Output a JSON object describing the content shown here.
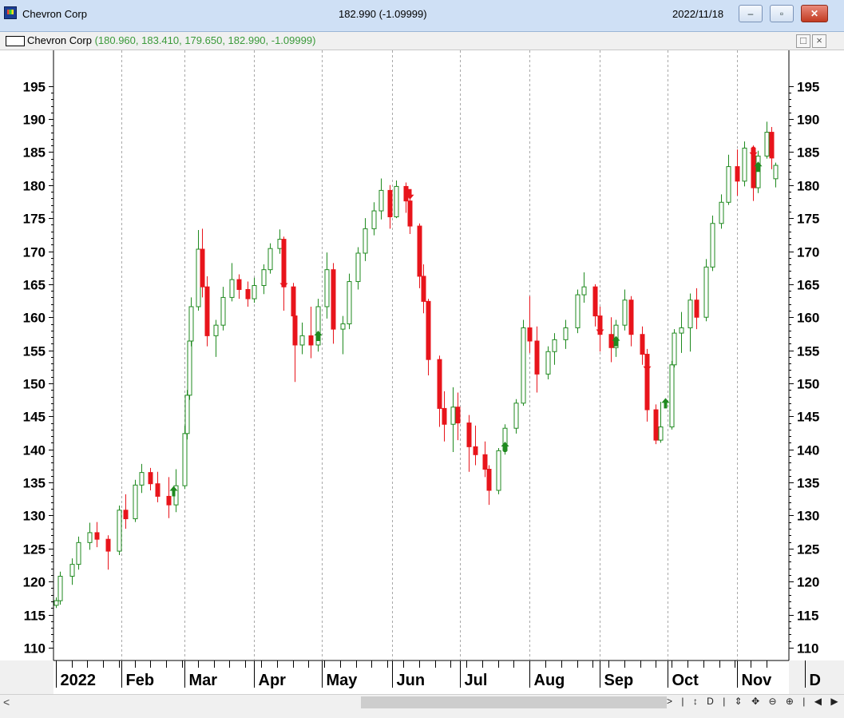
{
  "window": {
    "title": "Chevron Corp",
    "price_change": "182.990 (-1.09999)",
    "date": "2022/11/18",
    "minimize_label": "–",
    "maximize_label": "▫",
    "close_label": "✕"
  },
  "subwindow": {
    "title": "Chevron Corp",
    "ohlc": "(180.960, 183.410, 179.650, 182.990, -1.09999)",
    "restore_label": "□",
    "close_label": "×"
  },
  "scrollbar": {
    "left_arrow": "<",
    "tools": [
      ">",
      "|",
      "↕",
      "D",
      "|",
      "⇕",
      "✥",
      "⊖",
      "⊕",
      "|",
      "◀",
      "▶",
      "⊟"
    ]
  },
  "colors": {
    "up": "#1f8a1f",
    "down": "#e8141b",
    "grid": "#a8a8a8"
  },
  "chart_data": {
    "type": "candlestick",
    "title": "Chevron Corp",
    "y_ticks": [
      195,
      190,
      185,
      180,
      175,
      170,
      165,
      160,
      155,
      150,
      145,
      140,
      135,
      130,
      125,
      120,
      115,
      110
    ],
    "ylim": [
      109.5,
      197.5
    ],
    "x_labels": [
      "2022",
      "Feb",
      "Mar",
      "Apr",
      "May",
      "Jun",
      "Jul",
      "Aug",
      "Sep",
      "Oct",
      "Nov",
      "D"
    ],
    "grid": "vertical dashed at month boundaries",
    "series": [
      {
        "date": "2022-01-03",
        "o": 116.4,
        "h": 117.6,
        "l": 116.0,
        "c": 117.1
      },
      {
        "date": "2022-01-05",
        "o": 117.1,
        "h": 121.5,
        "l": 116.5,
        "c": 120.8
      },
      {
        "date": "2022-01-10",
        "o": 120.8,
        "h": 123.5,
        "l": 119.5,
        "c": 122.6
      },
      {
        "date": "2022-01-13",
        "o": 122.6,
        "h": 126.8,
        "l": 121.8,
        "c": 125.9
      },
      {
        "date": "2022-01-18",
        "o": 125.9,
        "h": 128.9,
        "l": 124.8,
        "c": 127.4
      },
      {
        "date": "2022-01-21",
        "o": 127.4,
        "h": 129.0,
        "l": 125.2,
        "c": 126.4
      },
      {
        "date": "2022-01-26",
        "o": 126.4,
        "h": 127.0,
        "l": 121.8,
        "c": 124.6
      },
      {
        "date": "2022-01-31",
        "o": 124.6,
        "h": 131.5,
        "l": 124.0,
        "c": 130.8
      },
      {
        "date": "2022-02-03",
        "o": 130.8,
        "h": 133.2,
        "l": 128.0,
        "c": 129.5
      },
      {
        "date": "2022-02-07",
        "o": 129.5,
        "h": 135.4,
        "l": 129.0,
        "c": 134.6
      },
      {
        "date": "2022-02-10",
        "o": 134.6,
        "h": 137.8,
        "l": 133.4,
        "c": 136.5
      },
      {
        "date": "2022-02-14",
        "o": 136.5,
        "h": 137.2,
        "l": 133.8,
        "c": 134.8
      },
      {
        "date": "2022-02-17",
        "o": 134.8,
        "h": 136.6,
        "l": 132.0,
        "c": 132.9
      },
      {
        "date": "2022-02-22",
        "o": 132.9,
        "h": 135.8,
        "l": 129.6,
        "c": 131.6
      },
      {
        "date": "2022-02-25",
        "o": 131.6,
        "h": 137.0,
        "l": 130.5,
        "c": 134.5
      },
      {
        "date": "2022-03-01",
        "o": 134.5,
        "h": 143.6,
        "l": 134.0,
        "c": 142.4
      },
      {
        "date": "2022-03-02",
        "o": 142.4,
        "h": 149.0,
        "l": 141.5,
        "c": 148.2
      },
      {
        "date": "2022-03-03",
        "o": 148.2,
        "h": 157.6,
        "l": 147.5,
        "c": 156.4
      },
      {
        "date": "2022-03-04",
        "o": 156.4,
        "h": 163.0,
        "l": 155.6,
        "c": 161.6
      },
      {
        "date": "2022-03-07",
        "o": 161.6,
        "h": 173.2,
        "l": 161.0,
        "c": 170.3
      },
      {
        "date": "2022-03-09",
        "o": 170.3,
        "h": 173.4,
        "l": 163.0,
        "c": 164.6
      },
      {
        "date": "2022-03-11",
        "o": 164.6,
        "h": 166.2,
        "l": 155.6,
        "c": 157.2
      },
      {
        "date": "2022-03-15",
        "o": 157.2,
        "h": 159.6,
        "l": 154.0,
        "c": 158.8
      },
      {
        "date": "2022-03-18",
        "o": 158.8,
        "h": 164.6,
        "l": 158.0,
        "c": 163.0
      },
      {
        "date": "2022-03-22",
        "o": 163.0,
        "h": 168.2,
        "l": 162.4,
        "c": 165.7
      },
      {
        "date": "2022-03-25",
        "o": 165.7,
        "h": 166.5,
        "l": 162.8,
        "c": 164.2
      },
      {
        "date": "2022-03-29",
        "o": 164.2,
        "h": 165.4,
        "l": 161.6,
        "c": 162.8
      },
      {
        "date": "2022-04-01",
        "o": 162.8,
        "h": 166.0,
        "l": 162.2,
        "c": 164.8
      },
      {
        "date": "2022-04-05",
        "o": 164.8,
        "h": 168.0,
        "l": 163.5,
        "c": 167.2
      },
      {
        "date": "2022-04-08",
        "o": 167.2,
        "h": 171.2,
        "l": 166.6,
        "c": 170.4
      },
      {
        "date": "2022-04-12",
        "o": 170.4,
        "h": 173.3,
        "l": 169.6,
        "c": 171.8
      },
      {
        "date": "2022-04-14",
        "o": 171.8,
        "h": 172.2,
        "l": 161.0,
        "c": 164.6
      },
      {
        "date": "2022-04-18",
        "o": 164.6,
        "h": 165.2,
        "l": 158.6,
        "c": 160.2
      },
      {
        "date": "2022-04-19",
        "o": 160.2,
        "h": 160.5,
        "l": 150.2,
        "c": 155.8
      },
      {
        "date": "2022-04-22",
        "o": 155.8,
        "h": 159.2,
        "l": 154.4,
        "c": 157.2
      },
      {
        "date": "2022-04-26",
        "o": 157.2,
        "h": 161.6,
        "l": 153.8,
        "c": 155.8
      },
      {
        "date": "2022-04-29",
        "o": 155.8,
        "h": 162.8,
        "l": 154.8,
        "c": 161.6
      },
      {
        "date": "2022-05-03",
        "o": 161.6,
        "h": 169.8,
        "l": 159.8,
        "c": 167.2
      },
      {
        "date": "2022-05-06",
        "o": 167.2,
        "h": 168.2,
        "l": 156.0,
        "c": 158.2
      },
      {
        "date": "2022-05-10",
        "o": 158.2,
        "h": 160.2,
        "l": 154.4,
        "c": 159.0
      },
      {
        "date": "2022-05-13",
        "o": 159.0,
        "h": 166.6,
        "l": 158.2,
        "c": 165.4
      },
      {
        "date": "2022-05-17",
        "o": 165.4,
        "h": 170.6,
        "l": 164.2,
        "c": 169.7
      },
      {
        "date": "2022-05-20",
        "o": 169.7,
        "h": 175.0,
        "l": 168.5,
        "c": 173.4
      },
      {
        "date": "2022-05-24",
        "o": 173.4,
        "h": 177.4,
        "l": 172.4,
        "c": 176.1
      },
      {
        "date": "2022-05-27",
        "o": 176.1,
        "h": 181.0,
        "l": 174.8,
        "c": 179.2
      },
      {
        "date": "2022-05-31",
        "o": 179.2,
        "h": 180.0,
        "l": 173.4,
        "c": 175.2
      },
      {
        "date": "2022-06-03",
        "o": 175.2,
        "h": 180.7,
        "l": 175.0,
        "c": 179.8
      },
      {
        "date": "2022-06-07",
        "o": 179.8,
        "h": 180.4,
        "l": 175.8,
        "c": 177.6
      },
      {
        "date": "2022-06-09",
        "o": 177.6,
        "h": 178.0,
        "l": 172.6,
        "c": 173.8
      },
      {
        "date": "2022-06-13",
        "o": 173.8,
        "h": 174.2,
        "l": 164.4,
        "c": 166.2
      },
      {
        "date": "2022-06-15",
        "o": 166.2,
        "h": 168.0,
        "l": 160.6,
        "c": 162.4
      },
      {
        "date": "2022-06-17",
        "o": 162.4,
        "h": 162.8,
        "l": 151.2,
        "c": 153.6
      },
      {
        "date": "2022-06-22",
        "o": 153.6,
        "h": 154.2,
        "l": 143.4,
        "c": 146.2
      },
      {
        "date": "2022-06-24",
        "o": 146.2,
        "h": 148.8,
        "l": 141.2,
        "c": 143.8
      },
      {
        "date": "2022-06-28",
        "o": 143.8,
        "h": 149.4,
        "l": 139.6,
        "c": 146.4
      },
      {
        "date": "2022-06-30",
        "o": 146.4,
        "h": 148.6,
        "l": 141.4,
        "c": 144.0
      },
      {
        "date": "2022-07-05",
        "o": 144.0,
        "h": 145.2,
        "l": 136.6,
        "c": 140.4
      },
      {
        "date": "2022-07-08",
        "o": 140.4,
        "h": 143.6,
        "l": 137.6,
        "c": 139.2
      },
      {
        "date": "2022-07-12",
        "o": 139.2,
        "h": 141.2,
        "l": 135.8,
        "c": 137.0
      },
      {
        "date": "2022-07-14",
        "o": 137.0,
        "h": 137.6,
        "l": 131.6,
        "c": 133.8
      },
      {
        "date": "2022-07-18",
        "o": 133.8,
        "h": 140.2,
        "l": 133.2,
        "c": 139.8
      },
      {
        "date": "2022-07-21",
        "o": 139.8,
        "h": 143.8,
        "l": 139.2,
        "c": 143.2
      },
      {
        "date": "2022-07-26",
        "o": 143.2,
        "h": 147.6,
        "l": 142.4,
        "c": 147.0
      },
      {
        "date": "2022-07-29",
        "o": 147.0,
        "h": 159.6,
        "l": 146.6,
        "c": 158.4
      },
      {
        "date": "2022-08-01",
        "o": 158.4,
        "h": 163.2,
        "l": 154.6,
        "c": 156.4
      },
      {
        "date": "2022-08-04",
        "o": 156.4,
        "h": 158.6,
        "l": 148.6,
        "c": 151.4
      },
      {
        "date": "2022-08-09",
        "o": 151.4,
        "h": 155.6,
        "l": 150.6,
        "c": 154.8
      },
      {
        "date": "2022-08-12",
        "o": 154.8,
        "h": 157.6,
        "l": 152.8,
        "c": 156.6
      },
      {
        "date": "2022-08-17",
        "o": 156.6,
        "h": 159.6,
        "l": 155.2,
        "c": 158.4
      },
      {
        "date": "2022-08-22",
        "o": 158.4,
        "h": 164.2,
        "l": 157.6,
        "c": 163.4
      },
      {
        "date": "2022-08-25",
        "o": 163.4,
        "h": 166.8,
        "l": 162.2,
        "c": 164.6
      },
      {
        "date": "2022-08-30",
        "o": 164.6,
        "h": 165.0,
        "l": 158.6,
        "c": 160.2
      },
      {
        "date": "2022-09-01",
        "o": 160.2,
        "h": 161.6,
        "l": 154.8,
        "c": 157.4
      },
      {
        "date": "2022-09-06",
        "o": 157.4,
        "h": 160.0,
        "l": 153.2,
        "c": 155.4
      },
      {
        "date": "2022-09-08",
        "o": 155.4,
        "h": 159.6,
        "l": 154.0,
        "c": 158.8
      },
      {
        "date": "2022-09-12",
        "o": 158.8,
        "h": 164.2,
        "l": 158.0,
        "c": 162.6
      },
      {
        "date": "2022-09-15",
        "o": 162.6,
        "h": 163.2,
        "l": 155.6,
        "c": 157.4
      },
      {
        "date": "2022-09-20",
        "o": 157.4,
        "h": 158.6,
        "l": 152.8,
        "c": 154.4
      },
      {
        "date": "2022-09-22",
        "o": 154.4,
        "h": 155.2,
        "l": 144.2,
        "c": 146.0
      },
      {
        "date": "2022-09-26",
        "o": 146.0,
        "h": 146.8,
        "l": 140.8,
        "c": 141.4
      },
      {
        "date": "2022-09-28",
        "o": 141.4,
        "h": 147.2,
        "l": 141.0,
        "c": 143.4
      },
      {
        "date": "2022-10-03",
        "o": 143.4,
        "h": 153.4,
        "l": 143.0,
        "c": 152.8
      },
      {
        "date": "2022-10-04",
        "o": 152.8,
        "h": 158.2,
        "l": 152.4,
        "c": 157.6
      },
      {
        "date": "2022-10-07",
        "o": 157.6,
        "h": 160.8,
        "l": 154.6,
        "c": 158.4
      },
      {
        "date": "2022-10-11",
        "o": 158.4,
        "h": 163.6,
        "l": 154.8,
        "c": 162.6
      },
      {
        "date": "2022-10-14",
        "o": 162.6,
        "h": 164.4,
        "l": 158.2,
        "c": 160.0
      },
      {
        "date": "2022-10-18",
        "o": 160.0,
        "h": 168.8,
        "l": 159.4,
        "c": 167.6
      },
      {
        "date": "2022-10-21",
        "o": 167.6,
        "h": 175.4,
        "l": 167.0,
        "c": 174.2
      },
      {
        "date": "2022-10-25",
        "o": 174.2,
        "h": 178.6,
        "l": 173.4,
        "c": 177.4
      },
      {
        "date": "2022-10-28",
        "o": 177.4,
        "h": 184.6,
        "l": 177.0,
        "c": 182.8
      },
      {
        "date": "2022-11-01",
        "o": 182.8,
        "h": 185.4,
        "l": 178.4,
        "c": 180.6
      },
      {
        "date": "2022-11-04",
        "o": 180.6,
        "h": 186.6,
        "l": 179.8,
        "c": 185.6
      },
      {
        "date": "2022-11-08",
        "o": 185.6,
        "h": 186.0,
        "l": 177.6,
        "c": 179.6
      },
      {
        "date": "2022-11-10",
        "o": 179.6,
        "h": 185.2,
        "l": 178.8,
        "c": 184.4
      },
      {
        "date": "2022-11-14",
        "o": 184.4,
        "h": 189.6,
        "l": 184.0,
        "c": 188.0
      },
      {
        "date": "2022-11-16",
        "o": 188.0,
        "h": 188.8,
        "l": 182.4,
        "c": 184.1
      },
      {
        "date": "2022-11-18",
        "o": 180.96,
        "h": 183.41,
        "l": 179.65,
        "c": 182.99
      }
    ],
    "signals": [
      {
        "date": "2022-02-24",
        "dir": "up",
        "price": 133.5
      },
      {
        "date": "2022-04-14",
        "dir": "down",
        "price": 165.4
      },
      {
        "date": "2022-04-29",
        "dir": "up",
        "price": 157.0
      },
      {
        "date": "2022-06-09",
        "dir": "down",
        "price": 178.8
      },
      {
        "date": "2022-07-21",
        "dir": "up",
        "price": 140.2
      },
      {
        "date": "2022-09-01",
        "dir": "down",
        "price": 158.4
      },
      {
        "date": "2022-09-08",
        "dir": "up",
        "price": 156.2
      },
      {
        "date": "2022-09-22",
        "dir": "down",
        "price": 152.8
      },
      {
        "date": "2022-09-30",
        "dir": "up",
        "price": 146.8
      },
      {
        "date": "2022-11-08",
        "dir": "down",
        "price": 185.2
      },
      {
        "date": "2022-11-10",
        "dir": "up",
        "price": 182.6
      }
    ]
  }
}
